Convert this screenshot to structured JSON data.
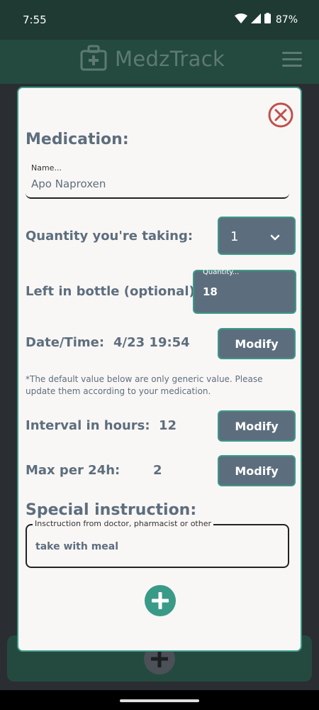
{
  "status_bar": {
    "time": "7:55",
    "battery": "87%"
  },
  "app": {
    "title": "MedzTrack"
  },
  "form": {
    "medication_heading": "Medication:",
    "name_label": "Name...",
    "name_value": "Apo Naproxen",
    "quantity_label": "Quantity you're taking:",
    "quantity_value": "1",
    "left_label": "Left in bottle (optional):",
    "left_field_label": "Quantity...",
    "left_value": "18",
    "datetime_label": "Date/Time:",
    "datetime_value": "4/23 19:54",
    "modify_label": "Modify",
    "note": "*The default value below are only generic value. Please update them according to your medication.",
    "interval_label": "Interval in hours:",
    "interval_value": "12",
    "max_label": "Max per 24h:",
    "max_value": "2",
    "special_heading": "Special instruction:",
    "instruction_label": "Insctruction from doctor,  pharmacist or other",
    "instruction_value": "take with meal"
  },
  "colors": {
    "accent": "#3a9a88",
    "slate": "#5c6e7e",
    "close": "#c0504d",
    "header": "#244a40"
  },
  "icons": [
    "wifi-icon",
    "signal-icon",
    "battery-icon",
    "medkit-icon",
    "menu-icon",
    "close-icon",
    "chevron-down-icon",
    "plus-icon"
  ]
}
